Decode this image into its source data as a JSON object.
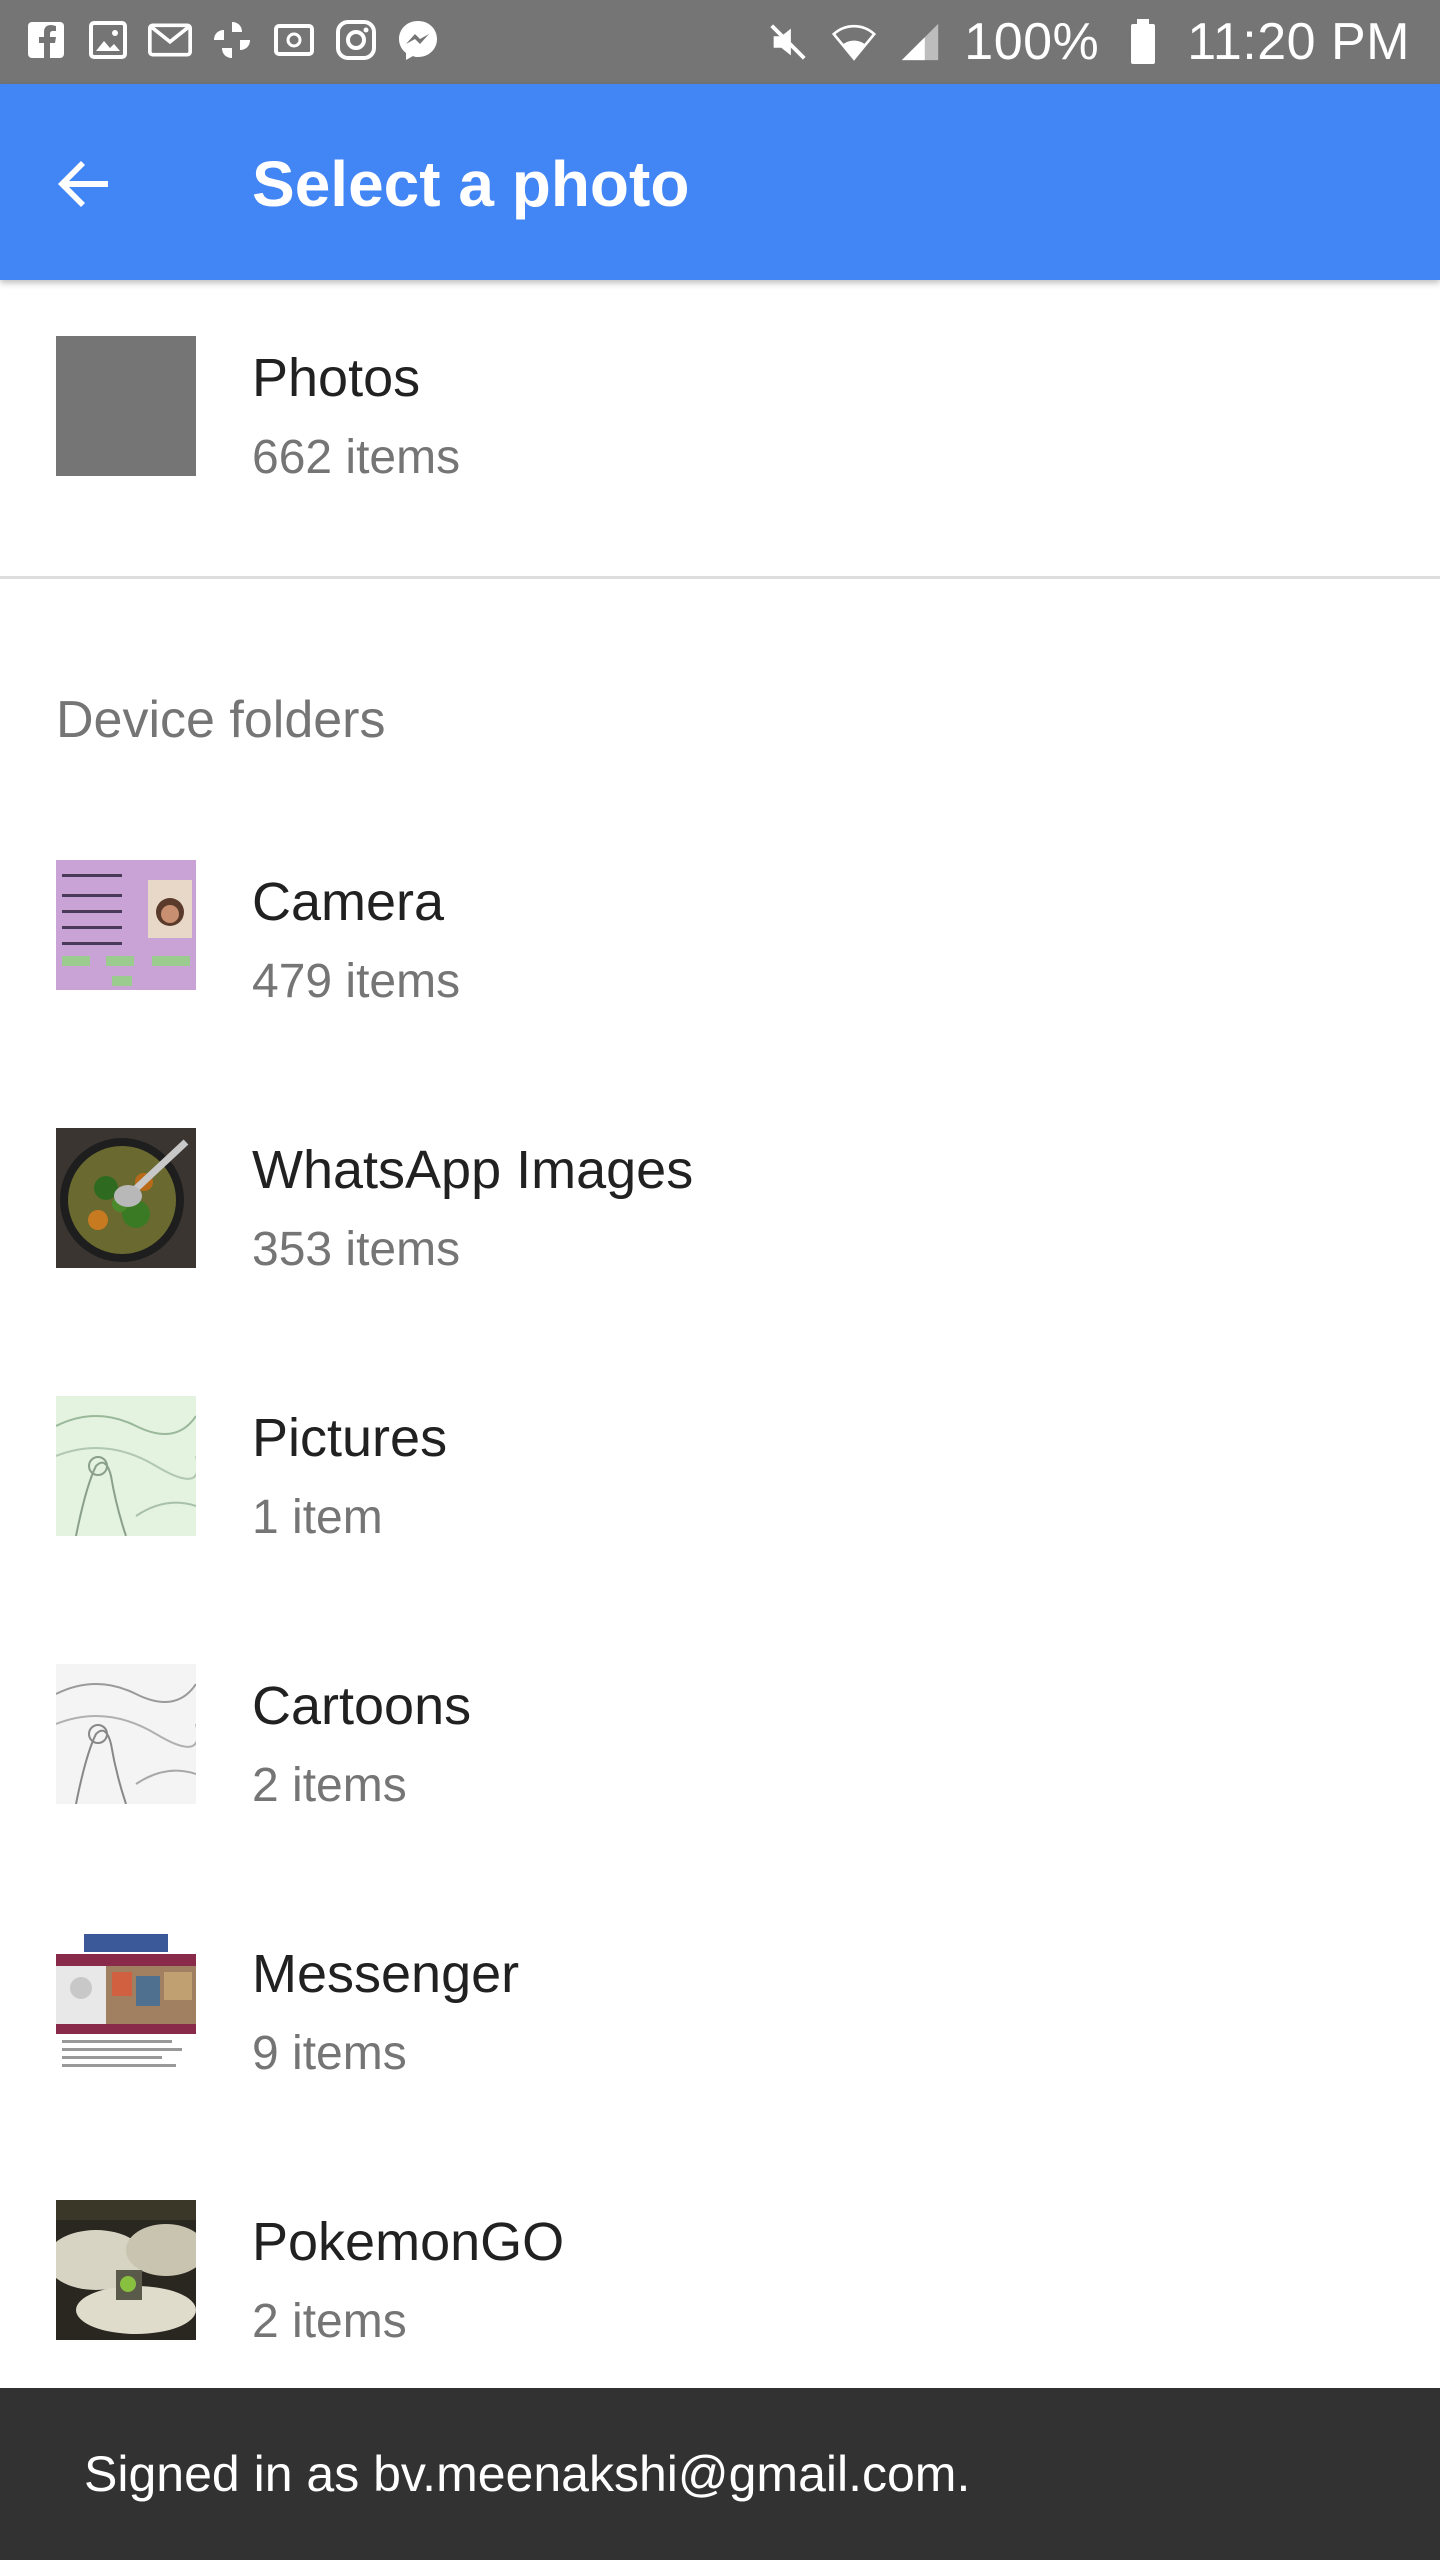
{
  "status_bar": {
    "notification_icons": [
      "facebook-icon",
      "gallery-icon",
      "gmail-icon",
      "pinwheel-icon",
      "cast-icon",
      "instagram-icon",
      "messenger-icon"
    ],
    "battery": "100%",
    "time": "11:20 PM"
  },
  "app_bar": {
    "title": "Select a photo",
    "back_icon": "arrow-back-icon",
    "color": "#4285f4"
  },
  "albums": [
    {
      "name": "Photos",
      "count": "662 items"
    }
  ],
  "device_folders": {
    "label": "Device folders",
    "items": [
      {
        "name": "Camera",
        "count": "479 items"
      },
      {
        "name": "WhatsApp Images",
        "count": "353 items"
      },
      {
        "name": "Pictures",
        "count": "1 item"
      },
      {
        "name": "Cartoons",
        "count": "2 items"
      },
      {
        "name": "Messenger",
        "count": "9 items"
      },
      {
        "name": "PokemonGO",
        "count": "2 items"
      }
    ]
  },
  "snackbar": {
    "text": "Signed in as bv.meenakshi@gmail.com."
  }
}
